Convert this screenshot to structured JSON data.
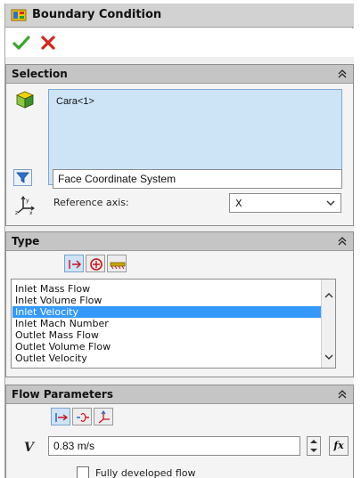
{
  "panel": {
    "title": "Boundary Condition"
  },
  "selection": {
    "header": "Selection",
    "items": [
      "Cara<1>"
    ],
    "coordinate_system": "Face Coordinate System",
    "reference_axis_label": "Reference axis:",
    "reference_axis_value": "X"
  },
  "type": {
    "header": "Type",
    "options": [
      "Inlet Mass Flow",
      "Inlet Volume Flow",
      "Inlet Velocity",
      "Inlet Mach Number",
      "Outlet Mass Flow",
      "Outlet Volume Flow",
      "Outlet Velocity"
    ],
    "selected": "Inlet Velocity"
  },
  "flow_parameters": {
    "header": "Flow Parameters",
    "velocity_symbol": "V",
    "velocity_value": "0.83 m/s",
    "fx_label": "fx",
    "fully_developed_label": "Fully developed flow",
    "fully_developed_checked": false
  },
  "colors": {
    "selection_box": "#cde4f7",
    "list_highlight": "#3399ff",
    "ok_green": "#3aa62e",
    "cancel_red": "#d4261b"
  }
}
